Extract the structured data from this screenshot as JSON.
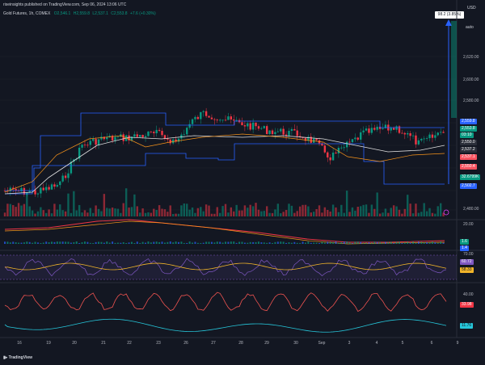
{
  "publisher_line": "riseinsights published on TradingView.com, Sep 06, 2024 13:06 UTC",
  "legend": {
    "symbol": "Gold Futures, 1h, COMEX",
    "o": "O2,546.1",
    "h": "H2,559.8",
    "l": "L2,537.1",
    "c": "C2,553.8",
    "change": "+7.6 (+0.30%)"
  },
  "currency": "USD",
  "scale_button": "auto",
  "target_box": "98.2 (3.85%) 982",
  "price_axis": [
    "2,620.00",
    "2,600.00",
    "2,580.00",
    "2,480.00"
  ],
  "price_tags": [
    {
      "text": "2,559.8",
      "color": "#2962ff"
    },
    {
      "text": "2,553.8",
      "color": "#089981"
    },
    {
      "text": "03:10",
      "color": "#089981"
    },
    {
      "text": "2,550.0",
      "color": "#2a2e39"
    },
    {
      "text": "2,537.2",
      "color": "#2a2e39"
    },
    {
      "text": "2,537.1",
      "color": "#f7525f"
    },
    {
      "text": "2,550.4",
      "color": "#f7525f"
    },
    {
      "text": "32.6799K",
      "color": "#089981"
    },
    {
      "text": "2,502.7",
      "color": "#2962ff"
    }
  ],
  "macd_axis": [
    "20.00",
    "1.6",
    "1.4"
  ],
  "rsi_axis": [
    "70.00",
    "60.72",
    "58.33"
  ],
  "osc1_axis": [
    "40.00",
    "33.98"
  ],
  "osc2_axis": [
    "11.76"
  ],
  "x_axis": [
    "16",
    "19",
    "20",
    "21",
    "22",
    "23",
    "26",
    "27",
    "28",
    "29",
    "30",
    "Sep",
    "3",
    "4",
    "5",
    "6",
    "9"
  ],
  "footer_brand": "TradingView",
  "colors": {
    "bg": "#131722",
    "up": "#089981",
    "down": "#f23645",
    "channel": "#2962ff",
    "ma_orange": "#f7931a",
    "ma_white": "#e0e0e0",
    "rsi_line": "#7e57c2",
    "rsi_signal": "#f0b429",
    "osc_red": "#ef5350",
    "osc_teal": "#26c6da"
  }
}
